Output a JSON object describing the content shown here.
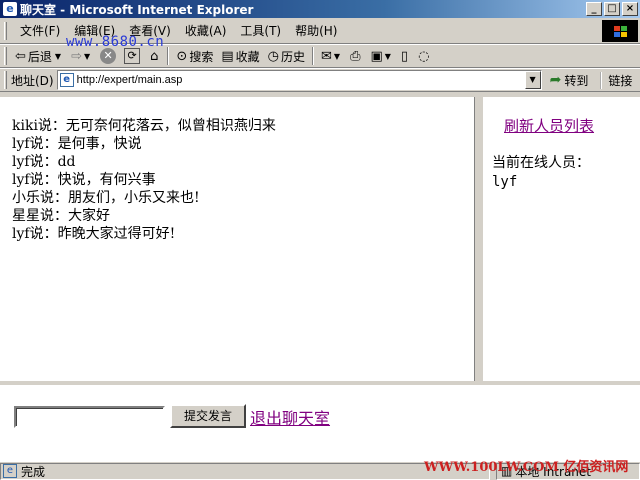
{
  "window": {
    "title": "聊天室 - Microsoft Internet Explorer",
    "controls": {
      "minimize": "_",
      "maximize": "□",
      "close": "×"
    }
  },
  "menu": [
    "文件(F)",
    "编辑(E)",
    "查看(V)",
    "收藏(A)",
    "工具(T)",
    "帮助(H)"
  ],
  "toolbar": {
    "back": "后退",
    "search": "搜索",
    "favorites": "收藏",
    "history": "历史"
  },
  "address": {
    "label": "地址(D)",
    "url": "http://expert/main.asp",
    "go": "转到",
    "links": "链接"
  },
  "chat": {
    "messages": [
      "kiki说：无可奈何花落云，似曾相识燕归来",
      "lyf说：是何事，快说",
      "lyf说：dd",
      "lyf说：快说，有何兴事",
      "小乐说：朋友们，小乐又来也!",
      "星星说：大家好",
      "lyf说：昨晚大家过得可好!"
    ]
  },
  "sidebar": {
    "refresh": "刷新人员列表",
    "online_label": "当前在线人员：",
    "online_users": [
      "lyf"
    ]
  },
  "input_bar": {
    "message_value": "",
    "submit": "提交发言",
    "exit": "退出聊天室"
  },
  "status": {
    "text": "完成",
    "zone": "本地 Intranet"
  },
  "watermarks": {
    "top": "www.8680.cn",
    "bottom": "WWW.100LW.COM 亿佰资讯网"
  },
  "colors": {
    "titlebar_start": "#0a246a",
    "visited_link": "#800080",
    "chrome": "#d4d0c8"
  }
}
